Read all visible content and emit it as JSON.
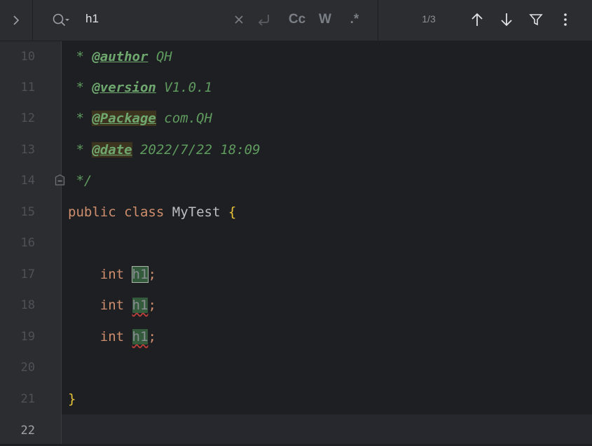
{
  "search": {
    "query": "h1",
    "match_counter": "1/3",
    "options": {
      "match_case_label": "Cc",
      "words_label": "W",
      "regex_label": ".*"
    }
  },
  "editor": {
    "line_numbers": [
      "10",
      "11",
      "12",
      "13",
      "14",
      "15",
      "16",
      "17",
      "18",
      "19",
      "20",
      "21",
      "22"
    ],
    "current_line": "22",
    "lines": {
      "l10": {
        "star": " * ",
        "tag": "@author",
        "text": " QH"
      },
      "l11": {
        "star": " * ",
        "tag": "@version",
        "text": " V1.0.1"
      },
      "l12": {
        "star": " * ",
        "tag": "@Package",
        "text": " com.QH"
      },
      "l13": {
        "star": " * ",
        "tag": "@date",
        "text": " 2022/7/22 18:09"
      },
      "l14": {
        "text": " */"
      },
      "l15": {
        "kw1": "public",
        "kw2": "class",
        "name": "MyTest",
        "brace": "{"
      },
      "l17": {
        "type": "int",
        "name": "h1",
        "semi": ";"
      },
      "l18": {
        "type": "int",
        "name": "h1",
        "semi": ";"
      },
      "l19": {
        "type": "int",
        "name": "h1",
        "semi": ";"
      },
      "l21": {
        "brace": "}"
      }
    }
  },
  "colors": {
    "background": "#1e1f22",
    "gutter": "#2b2d30",
    "keyword": "#cf8e6d",
    "comment": "#5f9b5f",
    "search_match": "#325a3b"
  }
}
